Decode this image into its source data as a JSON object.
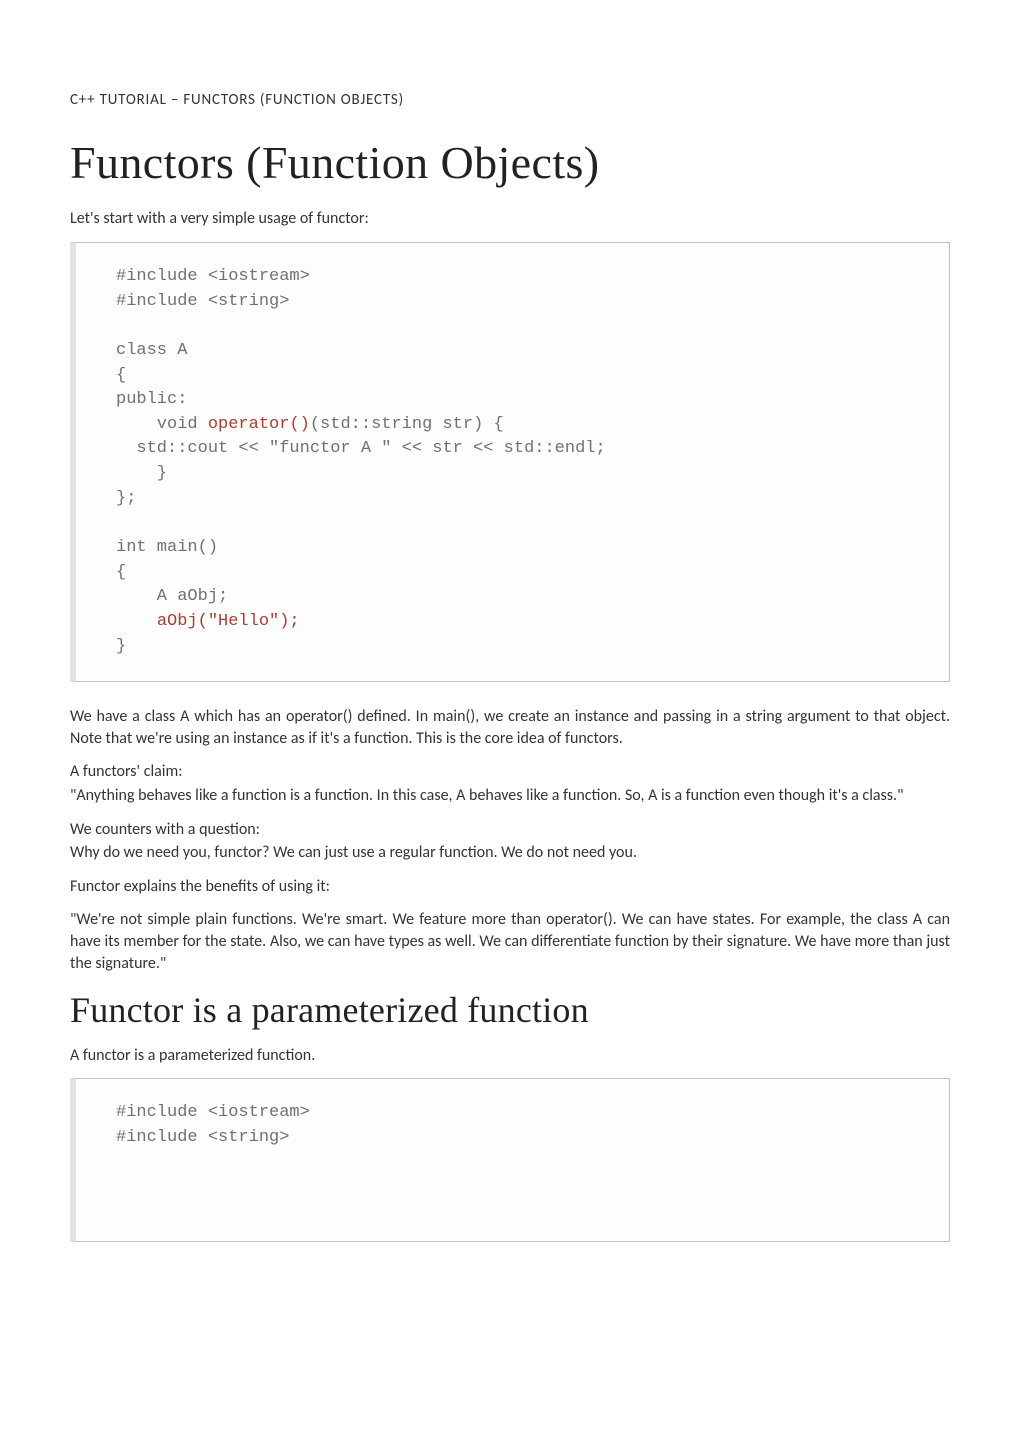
{
  "breadcrumb": "C++ TUTORIAL – FUNCTORS (FUNCTION OBJECTS)",
  "h1": "Functors (Function Objects)",
  "intro": "Let's start with a very simple usage of functor:",
  "paragraphs": {
    "p1": "We have a class A which has an operator() defined. In main(), we create an instance and passing in a string argument to that object. Note that we're using an instance as if it's a function. This is the core idea of functors.",
    "p2a": "A functors' claim:",
    "p2b": "\"Anything behaves like a function is a function. In this case, A behaves like a function. So, A is a function even though it's a class.\"",
    "p3a": "We counters with a question:",
    "p3b": "Why do we need you, functor? We can just use a regular function. We do not need you.",
    "p4": "Functor explains the benefits of using it:",
    "p5": "\"We're not simple plain functions. We're smart. We feature more than operator(). We can have states. For example, the class A can have its member for the state. Also, we can have types as well. We can differentiate function by their signature. We have more than just the signature.\""
  },
  "h2": "Functor is a parameterized function",
  "p6": "A functor is a parameterized function.",
  "code1": {
    "l01": "#include <iostream>",
    "l02": "#include <string>",
    "l03": "",
    "l04": "class A",
    "l05": "{",
    "l06": "public:",
    "l07a": "    void ",
    "l07b": "operator()",
    "l07c": "(std::string str) {",
    "l08": "  std::cout << \"functor A \" << str << std::endl;",
    "l09": "    }",
    "l10": "};",
    "l11": "",
    "l12": "int main()",
    "l13": "{",
    "l14": "    A aObj;",
    "l15a": "    ",
    "l15b": "aObj(\"Hello\");",
    "l16": "}"
  },
  "code2": {
    "l01": "#include <iostream>",
    "l02": "#include <string>"
  }
}
